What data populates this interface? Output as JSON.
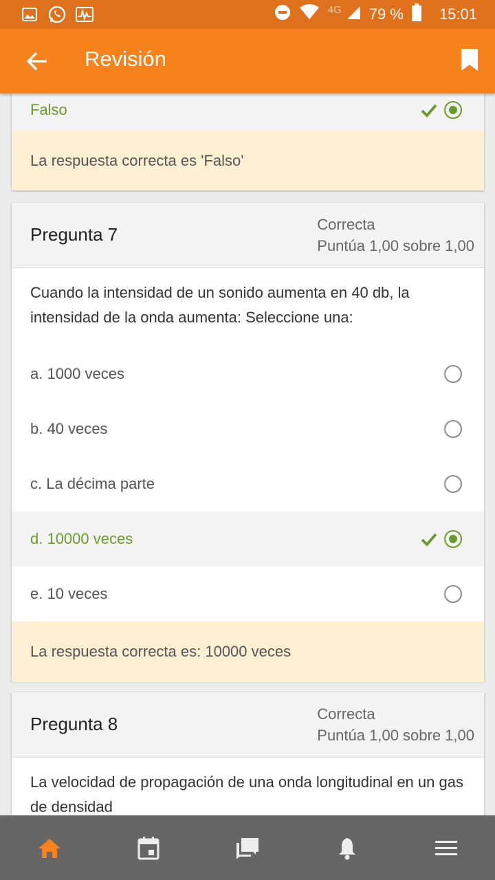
{
  "status_bar": {
    "battery": "79 %",
    "time": "15:01",
    "network": "4G"
  },
  "app_bar": {
    "title": "Revisión"
  },
  "prev_question": {
    "option": "Falso",
    "feedback": "La respuesta correcta es 'Falso'"
  },
  "q7": {
    "title": "Pregunta 7",
    "state": "Correcta",
    "grade": "Puntúa 1,00 sobre 1,00",
    "text": "Cuando la intensidad de un sonido aumenta en 40 db, la intensidad de la onda aumenta: Seleccione una:",
    "options": [
      {
        "label": "a. 1000 veces"
      },
      {
        "label": "b. 40 veces"
      },
      {
        "label": "c. La décima parte"
      },
      {
        "label": "d. 10000 veces"
      },
      {
        "label": "e. 10 veces"
      }
    ],
    "feedback": "La respuesta correcta es: 10000 veces"
  },
  "q8": {
    "title": "Pregunta 8",
    "state": "Correcta",
    "grade": "Puntúa 1,00 sobre 1,00",
    "text": "La velocidad de propagación de una onda longitudinal en un gas de densidad"
  },
  "bottom_nav": {
    "items": [
      {
        "icon": "home-icon",
        "active": true
      },
      {
        "icon": "calendar-icon",
        "active": false
      },
      {
        "icon": "messages-icon",
        "active": false
      },
      {
        "icon": "notifications-icon",
        "active": false
      },
      {
        "icon": "menu-icon",
        "active": false
      }
    ]
  },
  "colors": {
    "accent": "#f7821b",
    "status_bar": "#e0711c",
    "correct": "#6b9a2a",
    "feedback_bg": "#fcefd2",
    "nav_bg": "#666666"
  }
}
